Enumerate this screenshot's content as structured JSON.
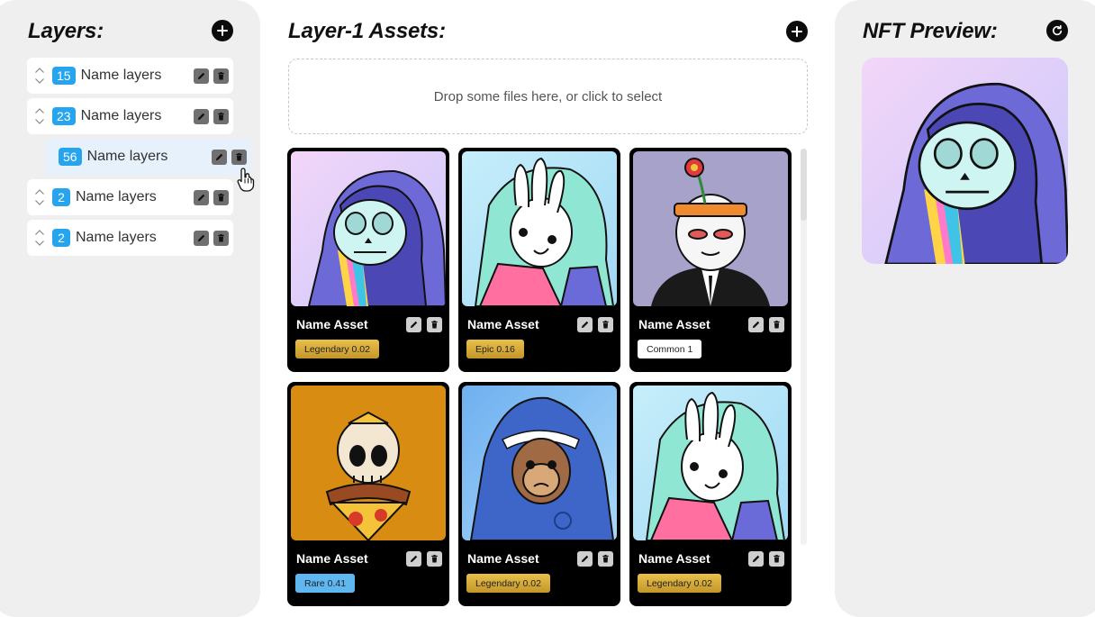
{
  "layers_panel": {
    "title": "Layers:",
    "add_icon": "plus-icon",
    "items": [
      {
        "count": "15",
        "label": "Name layers",
        "selected": false
      },
      {
        "count": "23",
        "label": "Name layers",
        "selected": false
      },
      {
        "count": "56",
        "label": "Name layers",
        "selected": true
      },
      {
        "count": "2",
        "label": "Name layers",
        "selected": false
      },
      {
        "count": "2",
        "label": "Name layers",
        "selected": false
      }
    ]
  },
  "assets_panel": {
    "title": "Layer-1 Assets:",
    "add_icon": "plus-icon",
    "dropzone_text": "Drop some files here, or click to select",
    "cards": [
      {
        "name": "Name Asset",
        "rarity": "Legendary 0.02",
        "art": "skull-hoodie-rainbow"
      },
      {
        "name": "Name Asset",
        "rarity": "Epic 0.16",
        "art": "bunny-peace-hoodie"
      },
      {
        "name": "Name Asset",
        "rarity": "Common 1",
        "art": "flower-headband-suit"
      },
      {
        "name": "Name Asset",
        "rarity": "Rare 0.41",
        "art": "pizza-skull"
      },
      {
        "name": "Name Asset",
        "rarity": "Legendary 0.02",
        "art": "monkey-shark-hoodie"
      },
      {
        "name": "Name Asset",
        "rarity": "Legendary 0.02",
        "art": "bunny-peace-hoodie"
      }
    ]
  },
  "preview_panel": {
    "title": "NFT Preview:",
    "refresh_icon": "refresh-icon",
    "art": "skull-hoodie-rainbow"
  },
  "colors": {
    "accent": "#27a4ee",
    "legendary": "#d4a833",
    "epic": "#d4a833",
    "common": "#ffffff",
    "rare": "#5fb7f2",
    "panel_bg": "#efefef"
  }
}
